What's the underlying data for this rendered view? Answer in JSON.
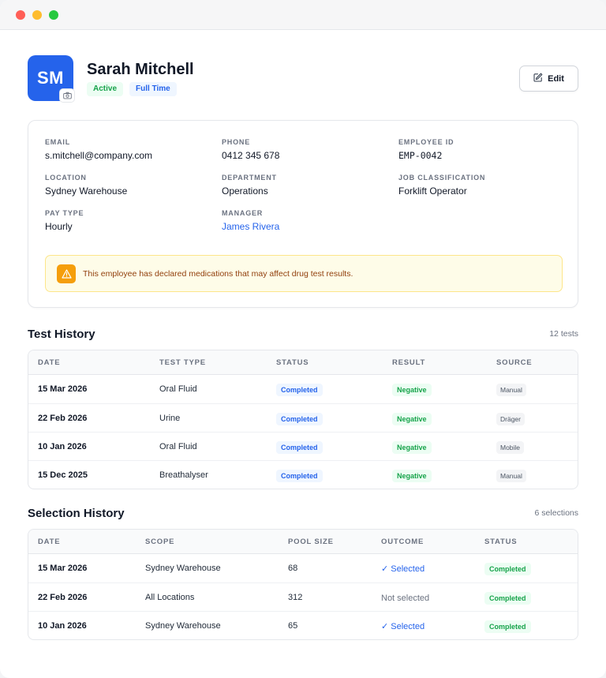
{
  "employee": {
    "initials": "SM",
    "name": "Sarah Mitchell",
    "badges": {
      "active": "Active",
      "fulltime": "Full Time"
    },
    "edit_label": "Edit"
  },
  "details": {
    "email": {
      "label": "EMAIL",
      "value": "s.mitchell@company.com"
    },
    "phone": {
      "label": "PHONE",
      "value": "0412 345 678"
    },
    "employee_id": {
      "label": "EMPLOYEE ID",
      "value": "EMP-0042"
    },
    "location": {
      "label": "LOCATION",
      "value": "Sydney Warehouse"
    },
    "department": {
      "label": "DEPARTMENT",
      "value": "Operations"
    },
    "job_classification": {
      "label": "JOB CLASSIFICATION",
      "value": "Forklift Operator"
    },
    "pay_type": {
      "label": "PAY TYPE",
      "value": "Hourly"
    },
    "manager": {
      "label": "MANAGER",
      "value": "James Rivera"
    },
    "warning": "This employee has declared medications that may affect drug test results."
  },
  "test_history": {
    "title": "Test History",
    "count": "12 tests",
    "columns": [
      "DATE",
      "TEST TYPE",
      "STATUS",
      "RESULT",
      "SOURCE"
    ],
    "rows": [
      {
        "date": "15 Mar 2026",
        "type": "Oral Fluid",
        "status": "Completed",
        "result": "Negative",
        "source": "Manual"
      },
      {
        "date": "22 Feb 2026",
        "type": "Urine",
        "status": "Completed",
        "result": "Negative",
        "source": "Dräger"
      },
      {
        "date": "10 Jan 2026",
        "type": "Oral Fluid",
        "status": "Completed",
        "result": "Negative",
        "source": "Mobile"
      },
      {
        "date": "15 Dec 2025",
        "type": "Breathalyser",
        "status": "Completed",
        "result": "Negative",
        "source": "Manual"
      }
    ]
  },
  "selection_history": {
    "title": "Selection History",
    "count": "6 selections",
    "columns": [
      "DATE",
      "SCOPE",
      "POOL SIZE",
      "OUTCOME",
      "STATUS"
    ],
    "rows": [
      {
        "date": "15 Mar 2026",
        "scope": "Sydney Warehouse",
        "pool": "68",
        "outcome": "Selected",
        "status": "Completed"
      },
      {
        "date": "22 Feb 2026",
        "scope": "All Locations",
        "pool": "312",
        "outcome": "Not selected",
        "status": "Completed"
      },
      {
        "date": "10 Jan 2026",
        "scope": "Sydney Warehouse",
        "pool": "65",
        "outcome": "Selected",
        "status": "Completed"
      }
    ]
  },
  "colors": {
    "accent": "#2563eb",
    "success": "#16a34a",
    "warning": "#f59e0b"
  }
}
